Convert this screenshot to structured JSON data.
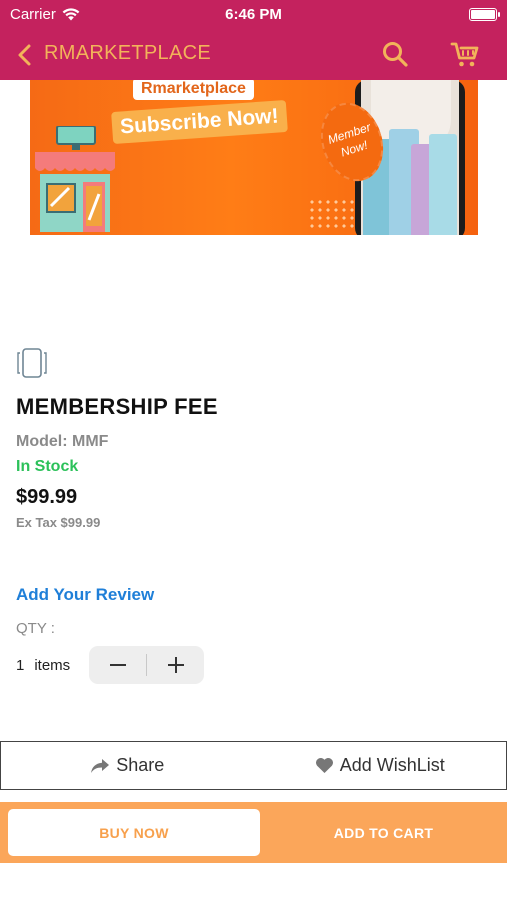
{
  "status_bar": {
    "carrier": "Carrier",
    "time": "6:46 PM"
  },
  "nav": {
    "title": "RMARKETPLACE",
    "accent_color": "#c4225e",
    "title_color": "#f2b35a"
  },
  "banner": {
    "brand": "Rmarketplace",
    "headline": "Subscribe Now!",
    "badge": "Member Now!"
  },
  "product": {
    "name": "MEMBERSHIP FEE",
    "model": "Model: MMF",
    "stock": "In Stock",
    "price": "$99.99",
    "ex_tax": "Ex Tax $99.99"
  },
  "review": {
    "link_label": "Add Your Review"
  },
  "quantity": {
    "label": "QTY :",
    "count": "1",
    "unit": "items"
  },
  "actions": {
    "share_label": "Share",
    "wishlist_label": "Add WishList"
  },
  "buttons": {
    "buy_now": "BUY NOW",
    "add_to_cart": "ADD TO CART"
  },
  "colors": {
    "stock_green": "#2cc15a",
    "link_blue": "#1f7fd8",
    "bottom_orange": "#fba65a"
  }
}
